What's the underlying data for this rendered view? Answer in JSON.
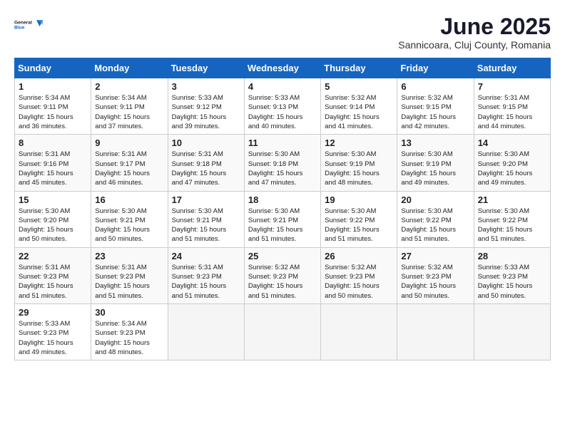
{
  "logo": {
    "line1": "General",
    "line2": "Blue"
  },
  "title": "June 2025",
  "location": "Sannicoara, Cluj County, Romania",
  "weekdays": [
    "Sunday",
    "Monday",
    "Tuesday",
    "Wednesday",
    "Thursday",
    "Friday",
    "Saturday"
  ],
  "weeks": [
    [
      {
        "day": "1",
        "info": "Sunrise: 5:34 AM\nSunset: 9:11 PM\nDaylight: 15 hours\nand 36 minutes."
      },
      {
        "day": "2",
        "info": "Sunrise: 5:34 AM\nSunset: 9:11 PM\nDaylight: 15 hours\nand 37 minutes."
      },
      {
        "day": "3",
        "info": "Sunrise: 5:33 AM\nSunset: 9:12 PM\nDaylight: 15 hours\nand 39 minutes."
      },
      {
        "day": "4",
        "info": "Sunrise: 5:33 AM\nSunset: 9:13 PM\nDaylight: 15 hours\nand 40 minutes."
      },
      {
        "day": "5",
        "info": "Sunrise: 5:32 AM\nSunset: 9:14 PM\nDaylight: 15 hours\nand 41 minutes."
      },
      {
        "day": "6",
        "info": "Sunrise: 5:32 AM\nSunset: 9:15 PM\nDaylight: 15 hours\nand 42 minutes."
      },
      {
        "day": "7",
        "info": "Sunrise: 5:31 AM\nSunset: 9:15 PM\nDaylight: 15 hours\nand 44 minutes."
      }
    ],
    [
      {
        "day": "8",
        "info": "Sunrise: 5:31 AM\nSunset: 9:16 PM\nDaylight: 15 hours\nand 45 minutes."
      },
      {
        "day": "9",
        "info": "Sunrise: 5:31 AM\nSunset: 9:17 PM\nDaylight: 15 hours\nand 46 minutes."
      },
      {
        "day": "10",
        "info": "Sunrise: 5:31 AM\nSunset: 9:18 PM\nDaylight: 15 hours\nand 47 minutes."
      },
      {
        "day": "11",
        "info": "Sunrise: 5:30 AM\nSunset: 9:18 PM\nDaylight: 15 hours\nand 47 minutes."
      },
      {
        "day": "12",
        "info": "Sunrise: 5:30 AM\nSunset: 9:19 PM\nDaylight: 15 hours\nand 48 minutes."
      },
      {
        "day": "13",
        "info": "Sunrise: 5:30 AM\nSunset: 9:19 PM\nDaylight: 15 hours\nand 49 minutes."
      },
      {
        "day": "14",
        "info": "Sunrise: 5:30 AM\nSunset: 9:20 PM\nDaylight: 15 hours\nand 49 minutes."
      }
    ],
    [
      {
        "day": "15",
        "info": "Sunrise: 5:30 AM\nSunset: 9:20 PM\nDaylight: 15 hours\nand 50 minutes."
      },
      {
        "day": "16",
        "info": "Sunrise: 5:30 AM\nSunset: 9:21 PM\nDaylight: 15 hours\nand 50 minutes."
      },
      {
        "day": "17",
        "info": "Sunrise: 5:30 AM\nSunset: 9:21 PM\nDaylight: 15 hours\nand 51 minutes."
      },
      {
        "day": "18",
        "info": "Sunrise: 5:30 AM\nSunset: 9:21 PM\nDaylight: 15 hours\nand 51 minutes."
      },
      {
        "day": "19",
        "info": "Sunrise: 5:30 AM\nSunset: 9:22 PM\nDaylight: 15 hours\nand 51 minutes."
      },
      {
        "day": "20",
        "info": "Sunrise: 5:30 AM\nSunset: 9:22 PM\nDaylight: 15 hours\nand 51 minutes."
      },
      {
        "day": "21",
        "info": "Sunrise: 5:30 AM\nSunset: 9:22 PM\nDaylight: 15 hours\nand 51 minutes."
      }
    ],
    [
      {
        "day": "22",
        "info": "Sunrise: 5:31 AM\nSunset: 9:23 PM\nDaylight: 15 hours\nand 51 minutes."
      },
      {
        "day": "23",
        "info": "Sunrise: 5:31 AM\nSunset: 9:23 PM\nDaylight: 15 hours\nand 51 minutes."
      },
      {
        "day": "24",
        "info": "Sunrise: 5:31 AM\nSunset: 9:23 PM\nDaylight: 15 hours\nand 51 minutes."
      },
      {
        "day": "25",
        "info": "Sunrise: 5:32 AM\nSunset: 9:23 PM\nDaylight: 15 hours\nand 51 minutes."
      },
      {
        "day": "26",
        "info": "Sunrise: 5:32 AM\nSunset: 9:23 PM\nDaylight: 15 hours\nand 50 minutes."
      },
      {
        "day": "27",
        "info": "Sunrise: 5:32 AM\nSunset: 9:23 PM\nDaylight: 15 hours\nand 50 minutes."
      },
      {
        "day": "28",
        "info": "Sunrise: 5:33 AM\nSunset: 9:23 PM\nDaylight: 15 hours\nand 50 minutes."
      }
    ],
    [
      {
        "day": "29",
        "info": "Sunrise: 5:33 AM\nSunset: 9:23 PM\nDaylight: 15 hours\nand 49 minutes."
      },
      {
        "day": "30",
        "info": "Sunrise: 5:34 AM\nSunset: 9:23 PM\nDaylight: 15 hours\nand 48 minutes."
      },
      {
        "day": "",
        "info": ""
      },
      {
        "day": "",
        "info": ""
      },
      {
        "day": "",
        "info": ""
      },
      {
        "day": "",
        "info": ""
      },
      {
        "day": "",
        "info": ""
      }
    ]
  ]
}
